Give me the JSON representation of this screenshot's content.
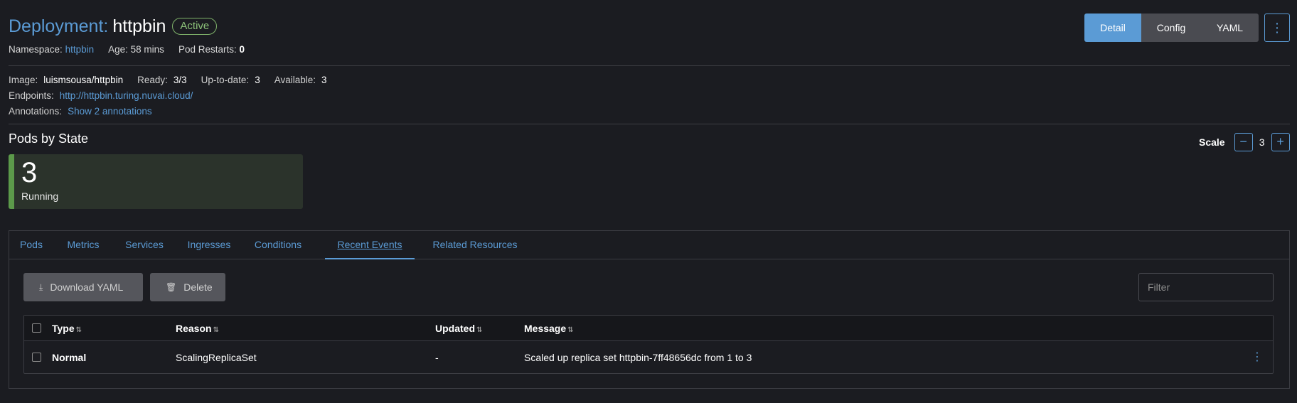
{
  "header": {
    "title_prefix": "Deployment:",
    "title_name": "httpbin",
    "status": "Active",
    "namespace_label": "Namespace:",
    "namespace_value": "httpbin",
    "age_label": "Age:",
    "age_value": "58 mins",
    "restarts_label": "Pod Restarts:",
    "restarts_value": "0"
  },
  "view_toggle": {
    "detail": "Detail",
    "config": "Config",
    "yaml": "YAML",
    "menu_icon": "kebab-vertical-icon"
  },
  "info": {
    "image_label": "Image:",
    "image_value": "luismsousa/httpbin",
    "ready_label": "Ready:",
    "ready_value": "3/3",
    "uptodate_label": "Up-to-date:",
    "uptodate_value": "3",
    "available_label": "Available:",
    "available_value": "3",
    "endpoints_label": "Endpoints:",
    "endpoints_value": "http://httpbin.turing.nuvai.cloud/",
    "annotations_label": "Annotations:",
    "annotations_value": "Show 2 annotations"
  },
  "pods_by_state": {
    "title": "Pods by State",
    "count": "3",
    "state": "Running",
    "color": "#5c9a4a"
  },
  "scale": {
    "label": "Scale",
    "minus": "−",
    "value": "3",
    "plus": "+"
  },
  "tabs": [
    {
      "label": "Pods"
    },
    {
      "label": "Metrics"
    },
    {
      "label": "Services"
    },
    {
      "label": "Ingresses"
    },
    {
      "label": "Conditions"
    },
    {
      "label": "Recent Events"
    },
    {
      "label": "Related Resources"
    }
  ],
  "actions": {
    "download_label": "Download YAML",
    "download_icon": "download-icon",
    "delete_label": "Delete",
    "delete_icon": "trash-icon",
    "filter_placeholder": "Filter"
  },
  "table": {
    "columns": [
      "Type",
      "Reason",
      "Updated",
      "Message"
    ],
    "rows": [
      {
        "type": "Normal",
        "reason": "ScalingReplicaSet",
        "updated": "-",
        "message": "Scaled up replica set httpbin-7ff48656dc from 1 to 3"
      }
    ]
  },
  "colors": {
    "accent": "#5b9bd5",
    "active_badge": "#8cc279",
    "background": "#1b1c21"
  }
}
